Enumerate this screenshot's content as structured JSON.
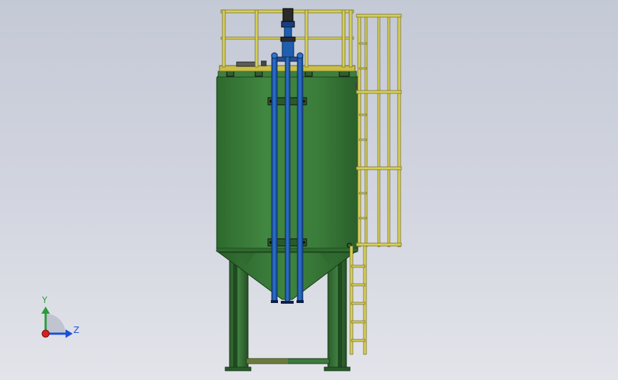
{
  "triad": {
    "y_label": "Y",
    "z_label": "Z",
    "colors": {
      "y": "#2a9d3a",
      "z": "#1c4fd8",
      "x": "#d42020"
    }
  },
  "model": {
    "tank_color": "#3a7a3a",
    "pipe_color": "#1f5fb0",
    "rail_color": "#d6cf59"
  }
}
